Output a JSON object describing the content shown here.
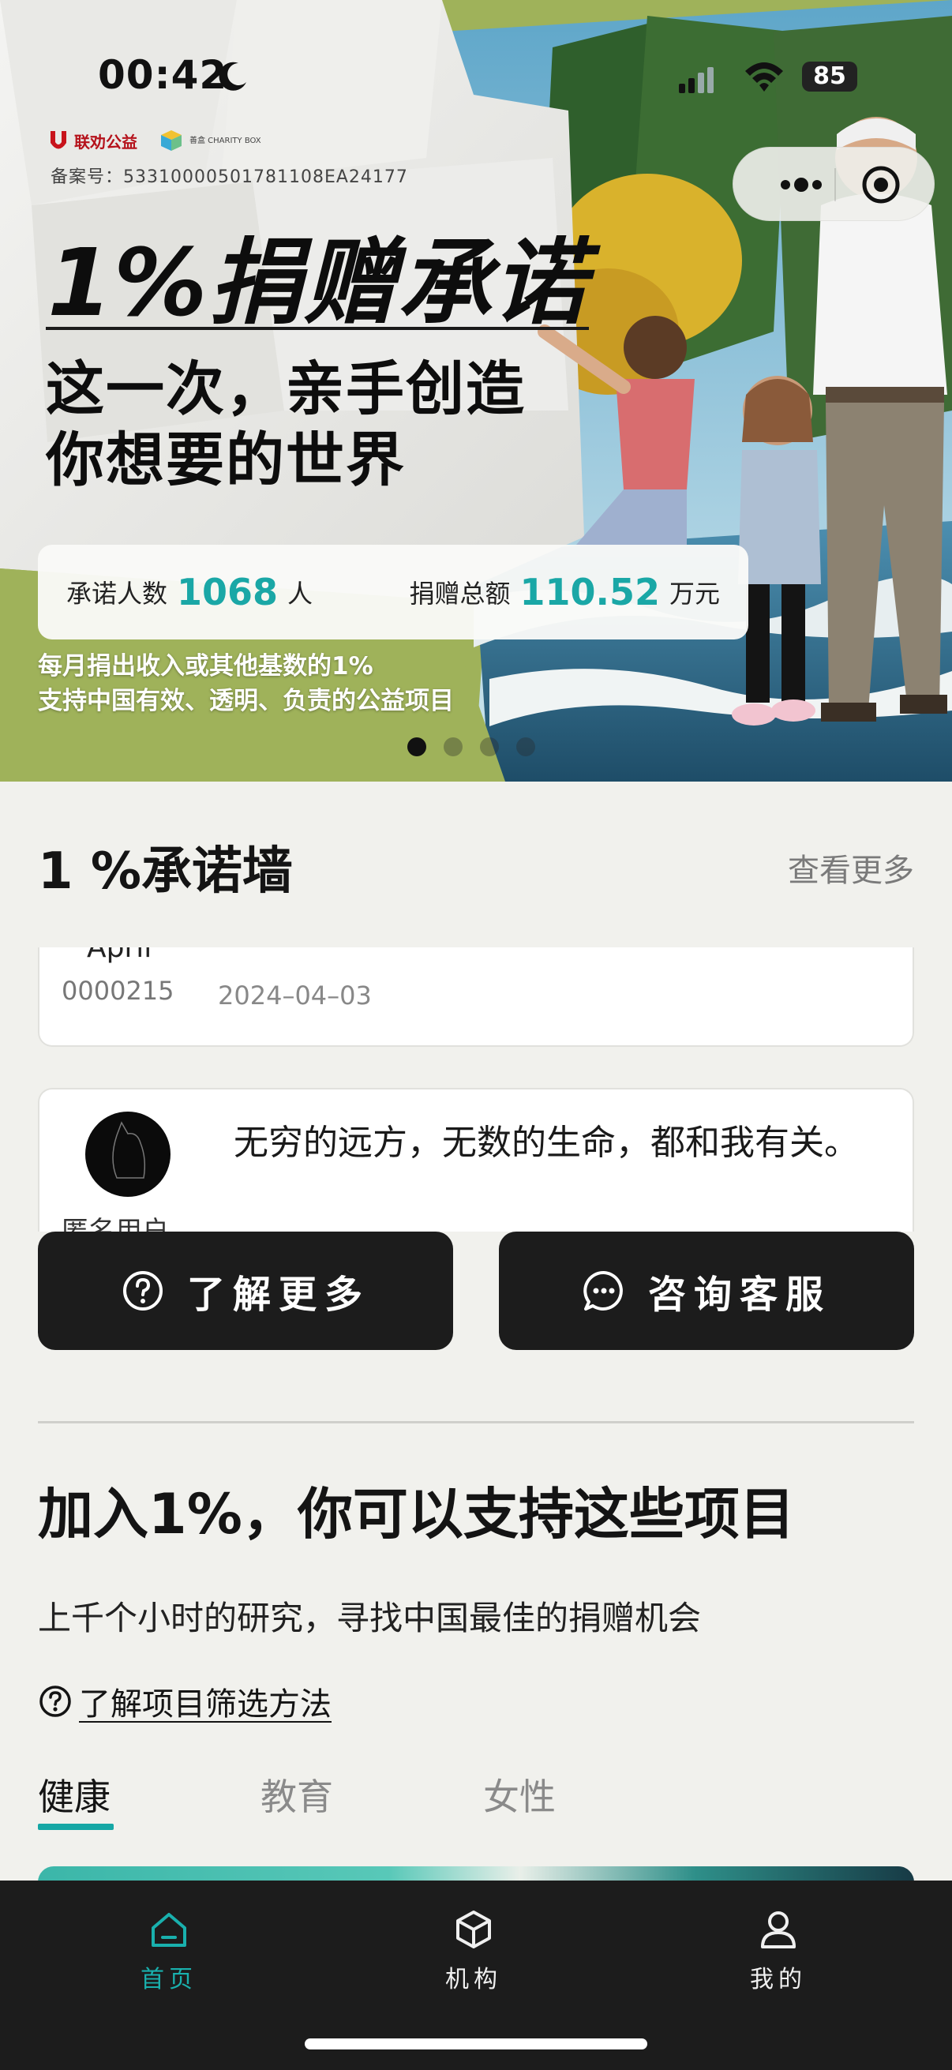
{
  "status_bar": {
    "time": "00:42",
    "battery": "85"
  },
  "hero": {
    "logo_lianquan": "联劝公益",
    "logo_charity_box": "善盒 CHARITY BOX",
    "record_number": "备案号：53310000501781108EA24177",
    "title": "1%捐赠承诺",
    "slogan_line1": "这一次，亲手创造",
    "slogan_line2": "你想要的世界",
    "stats": {
      "pledgers_label": "承诺人数",
      "pledgers_value": "1068",
      "pledgers_unit": "人",
      "total_label": "捐赠总额",
      "total_value": "110.52",
      "total_unit": "万元"
    },
    "subtitle_line1": "每月捐出收入或其他基数的1%",
    "subtitle_line2": "支持中国有效、透明、负责的公益项目",
    "carousel": {
      "count": 4,
      "active_index": 0
    }
  },
  "pledge_wall": {
    "title": "1 %承诺墙",
    "more_link": "查看更多",
    "cards": [
      {
        "name": "April",
        "id": "0000215",
        "date": "2024–04–03"
      },
      {
        "name": "匿名用户",
        "message": "无穷的远方，无数的生命，都和我有关。"
      }
    ]
  },
  "actions": {
    "learn_more": "了解更多",
    "customer_service": "咨询客服"
  },
  "projects": {
    "title": "加入1%，你可以支持这些项目",
    "subtitle": "上千个小时的研究，寻找中国最佳的捐赠机会",
    "method_link": "了解项目筛选方法",
    "tabs": [
      "健康",
      "教育",
      "女性"
    ],
    "active_tab": "健康"
  },
  "bottom_nav": {
    "home": "首页",
    "org": "机构",
    "me": "我的"
  },
  "colors": {
    "accent": "#16a7a5",
    "dark": "#1c1c1c",
    "background": "#f1f1ed"
  }
}
